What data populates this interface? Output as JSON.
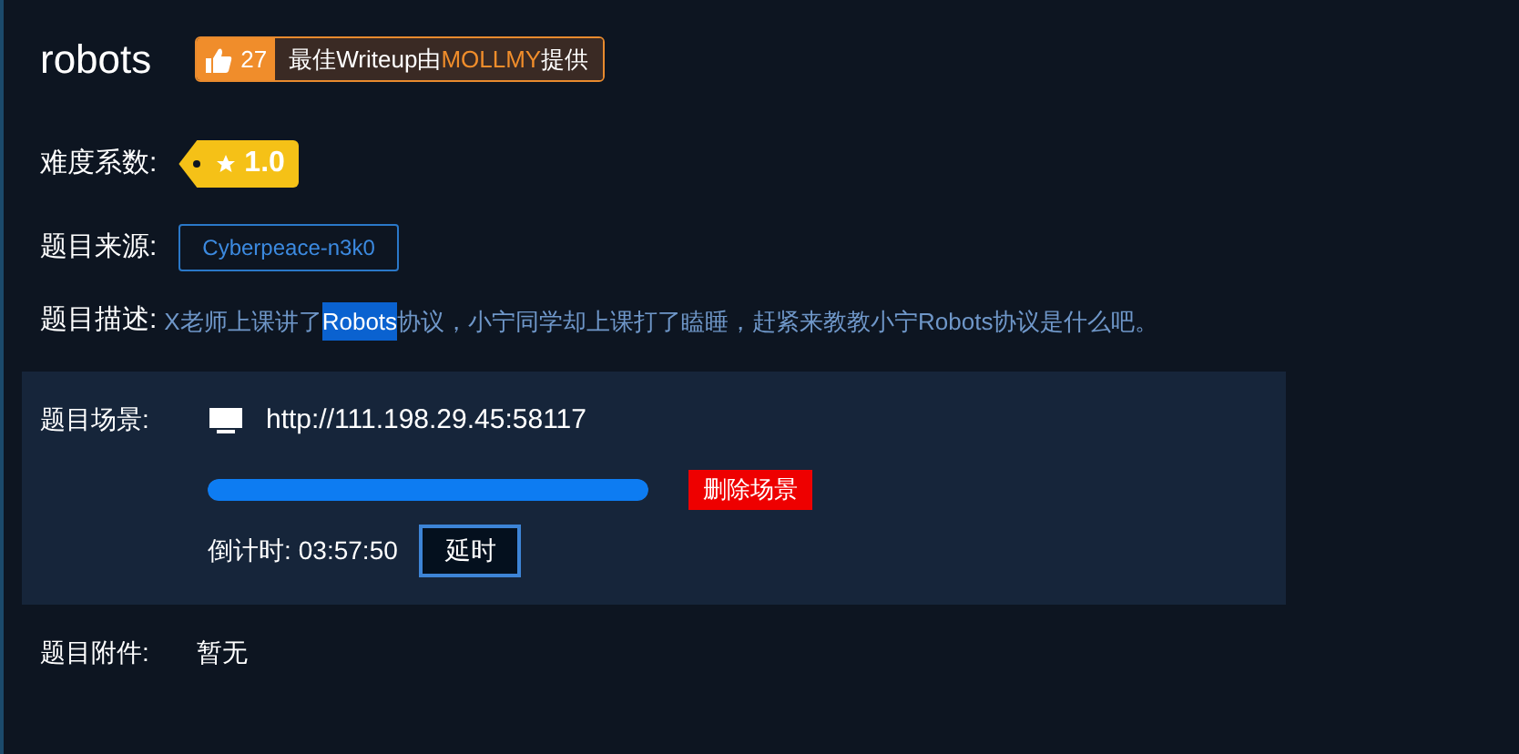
{
  "title": "robots",
  "likes": {
    "count": "27",
    "text_before": "最佳Writeup由",
    "author": "MOLLMY",
    "text_after": "提供"
  },
  "difficulty": {
    "label": "难度系数:",
    "value": "1.0"
  },
  "source": {
    "label": "题目来源:",
    "value": "Cyberpeace-n3k0"
  },
  "description": {
    "label": "题目描述:",
    "segments": [
      {
        "text": "X老师上课讲了",
        "highlighted": false
      },
      {
        "text": "Robots",
        "highlighted": true
      },
      {
        "text": "协议，小宁同学却上课打了瞌睡，赶紧来教教小宁Robots协议是什么吧。",
        "highlighted": false
      }
    ]
  },
  "scene": {
    "label": "题目场景:",
    "url": "http://111.198.29.45:58117",
    "progress": {
      "level": 1
    },
    "delete_button": "删除场景",
    "countdown_label": "倒计时:",
    "countdown": "03:57:50",
    "extend_button": "延时"
  },
  "attachments": {
    "label": "题目附件:",
    "value": "暂无"
  }
}
